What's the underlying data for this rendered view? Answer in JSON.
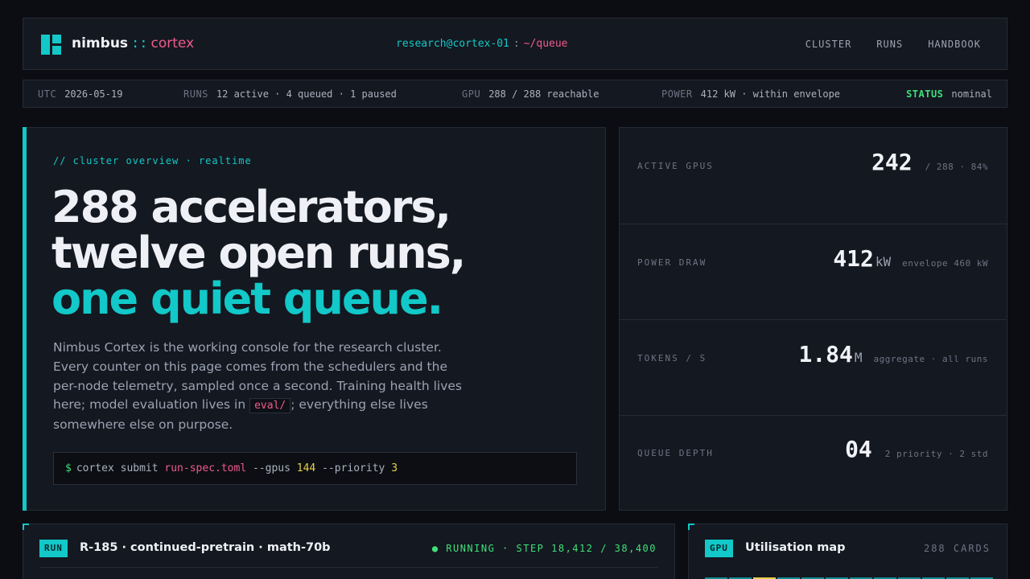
{
  "brand": {
    "name": "nimbus",
    "separator": "::",
    "product": "cortex"
  },
  "prompt": {
    "host": "research@cortex-01",
    "separator": ":",
    "path": "~/queue"
  },
  "nav": [
    "CLUSTER",
    "RUNS",
    "HANDBOOK"
  ],
  "status_strip": {
    "utc": {
      "key": "UTC",
      "value": "2026-05-19"
    },
    "runs": {
      "key": "RUNS",
      "value": "12 active · 4 queued · 1 paused"
    },
    "gpu": {
      "key": "GPU",
      "value": "288 / 288 reachable"
    },
    "power": {
      "key": "POWER",
      "value": "412 kW · within envelope"
    },
    "status": {
      "key": "STATUS",
      "value": "nominal"
    }
  },
  "hero": {
    "kicker": "// cluster overview · realtime",
    "headline": [
      "288 accelerators,",
      "twelve open runs,",
      "one quiet queue."
    ],
    "lede_before": "Nimbus Cortex is the working console for the research cluster. Every counter on this page comes from the schedulers and the per-node telemetry, sampled once a second. Training health lives here; model evaluation lives in ",
    "lede_code": "eval/",
    "lede_after": "; everything else lives somewhere else on purpose.",
    "command": {
      "prompt": "$",
      "base": "cortex submit ",
      "file": "run-spec.toml",
      "gpus_flag": " --gpus ",
      "gpus_value": "144",
      "priority_flag": " --priority ",
      "priority_value": "3"
    }
  },
  "metrics": [
    {
      "label": "ACTIVE GPUS",
      "value": "242",
      "unit": "",
      "note": "/ 288 · 84%"
    },
    {
      "label": "POWER DRAW",
      "value": "412",
      "unit": "kW",
      "note": "envelope 460 kW"
    },
    {
      "label": "TOKENS / S",
      "value": "1.84",
      "unit": "M",
      "note": "aggregate · all runs"
    },
    {
      "label": "QUEUE DEPTH",
      "value": "04",
      "unit": "",
      "note": "2 priority · 2 std"
    }
  ],
  "run_panel": {
    "tag": "RUN",
    "title": "R-185 · continued-pretrain · math-70b",
    "status": "● RUNNING · STEP 18,412 / 38,400"
  },
  "gpu_panel": {
    "tag": "GPU",
    "title": "Utilisation map",
    "count": "288 CARDS"
  },
  "colors": {
    "accent": "#12c8c8",
    "pink": "#f05a8a",
    "ok": "#3ee07a",
    "warn": "#e6cf4a",
    "bg": "#0b0d12",
    "panel": "#141820"
  }
}
